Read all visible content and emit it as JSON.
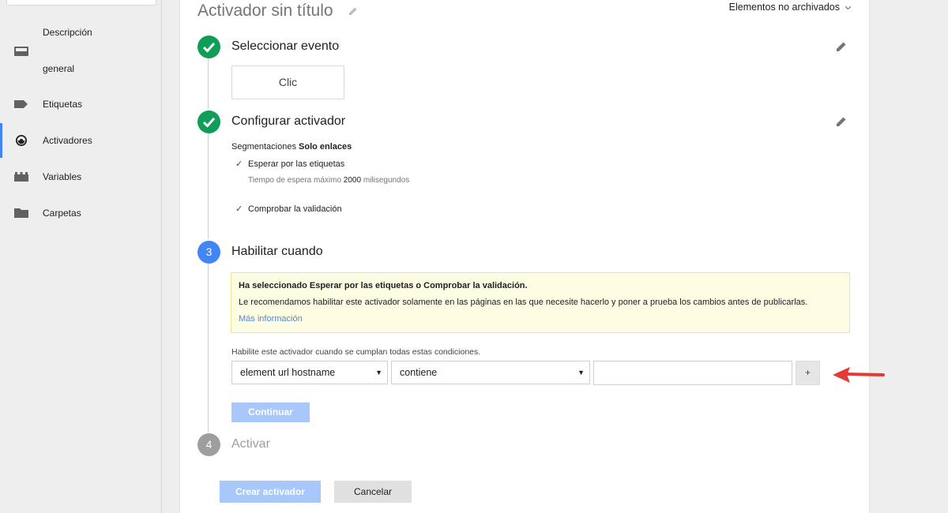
{
  "sidebar": {
    "items": [
      {
        "label_line1": "Descripción",
        "label_line2": "general",
        "icon": "inbox-icon",
        "active": false
      },
      {
        "label": "Etiquetas",
        "icon": "tag-icon",
        "active": false
      },
      {
        "label": "Activadores",
        "icon": "trigger-icon",
        "active": true
      },
      {
        "label": "Variables",
        "icon": "variables-icon",
        "active": false
      },
      {
        "label": "Carpetas",
        "icon": "folder-icon",
        "active": false
      }
    ]
  },
  "header": {
    "title": "Activador sin título",
    "archived_label": "Elementos no archivados"
  },
  "steps": [
    {
      "number": "",
      "title": "Seleccionar evento",
      "state": "done"
    },
    {
      "number": "",
      "title": "Configurar activador",
      "state": "done"
    },
    {
      "number": "3",
      "title": "Habilitar cuando",
      "state": "current"
    },
    {
      "number": "4",
      "title": "Activar",
      "state": "pending"
    }
  ],
  "event": {
    "value": "Clic"
  },
  "config": {
    "targeting_label": "Segmentaciones",
    "targeting_value": "Solo enlaces",
    "wait_tags": "Esperar por las etiquetas",
    "timeout_prefix": "Tiempo de espera máximo",
    "timeout_value": "2000",
    "timeout_suffix": "milisegundos",
    "check_validation": "Comprobar la validación"
  },
  "notice": {
    "title": "Ha seleccionado Esperar por las etiquetas o Comprobar la validación.",
    "body": "Le recomendamos habilitar este activador solamente en las páginas en las que necesite hacerlo y poner a prueba los cambios antes de publicarlas.",
    "link": "Más información"
  },
  "conditions": {
    "label": "Habilite este activador cuando se cumplan todas estas condiciones.",
    "variable": "element url hostname",
    "operator": "contiene",
    "value": "",
    "add_label": "+"
  },
  "buttons": {
    "continue": "Continuar",
    "create": "Crear activador",
    "cancel": "Cancelar"
  },
  "colors": {
    "accent": "#4285f4",
    "done": "#0f9d58",
    "pending": "#9e9e9e",
    "annotation_arrow": "#e53935"
  }
}
